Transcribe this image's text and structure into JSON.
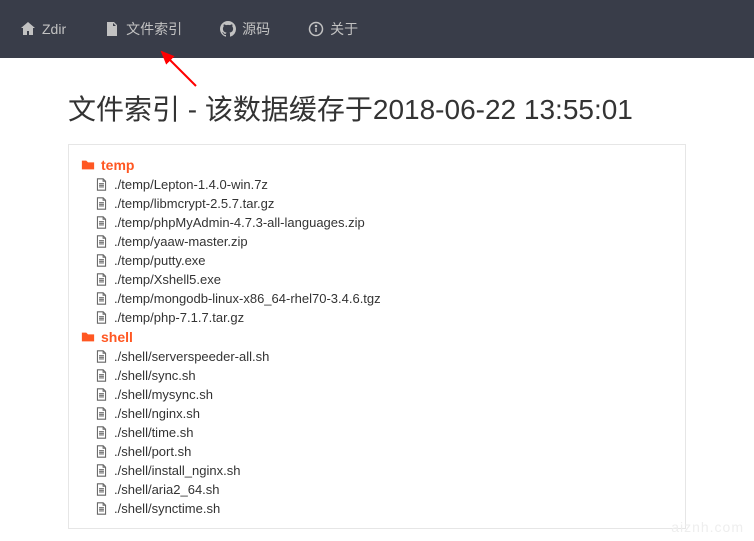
{
  "nav": {
    "home": "Zdir",
    "index": "文件索引",
    "source": "源码",
    "about": "关于"
  },
  "title": "文件索引 - 该数据缓存于2018-06-22 13:55:01",
  "folders": [
    {
      "name": "temp",
      "files": [
        "./temp/Lepton-1.4.0-win.7z",
        "./temp/libmcrypt-2.5.7.tar.gz",
        "./temp/phpMyAdmin-4.7.3-all-languages.zip",
        "./temp/yaaw-master.zip",
        "./temp/putty.exe",
        "./temp/Xshell5.exe",
        "./temp/mongodb-linux-x86_64-rhel70-3.4.6.tgz",
        "./temp/php-7.1.7.tar.gz"
      ]
    },
    {
      "name": "shell",
      "files": [
        "./shell/serverspeeder-all.sh",
        "./shell/sync.sh",
        "./shell/mysync.sh",
        "./shell/nginx.sh",
        "./shell/time.sh",
        "./shell/port.sh",
        "./shell/install_nginx.sh",
        "./shell/aria2_64.sh",
        "./shell/synctime.sh"
      ]
    }
  ],
  "watermark": "aiznh.com"
}
